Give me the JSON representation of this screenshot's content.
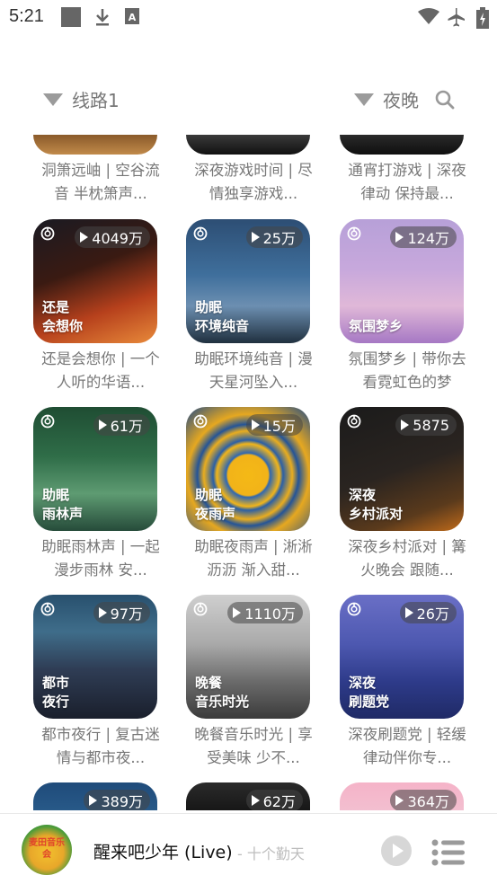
{
  "status_bar": {
    "time": "5:21"
  },
  "top_bar": {
    "route_label": "线路1",
    "mode_label": "夜晚"
  },
  "partial_top_row": [
    {
      "caption": "洞箫远岫 | 空谷流音 半枕箫声..."
    },
    {
      "caption": "深夜游戏时间 | 尽情独享游戏..."
    },
    {
      "caption": "通宵打游戏 | 深夜律动 保持最..."
    }
  ],
  "cards": [
    {
      "count": "4049万",
      "tag_line1": "还是",
      "tag_line2": "会想你",
      "caption": "还是会想你 | 一个人听的华语...",
      "bg": "linear-gradient(160deg,#1a1a22 0%,#3a1a12 40%,#b6401c 70%,#e88a3a 100%)"
    },
    {
      "count": "25万",
      "tag_line1": "助眠",
      "tag_line2": "环境纯音",
      "caption": "助眠环境纯音 | 漫天星河坠入...",
      "bg": "linear-gradient(180deg,#2d4e74 0%,#3f6f9c 45%,#6c8fb1 70%,#20303f 100%)"
    },
    {
      "count": "124万",
      "tag_line1": "氛围梦乡",
      "tag_line2": "",
      "caption": "氛围梦乡 | 带你去看霓虹色的梦",
      "bg": "linear-gradient(180deg,#b7a0d8 0%,#c7a8dc 40%,#e0b8d8 70%,#a678c4 100%)"
    },
    {
      "count": "61万",
      "tag_line1": "助眠",
      "tag_line2": "雨林声",
      "caption": "助眠雨林声 | 一起漫步雨林 安...",
      "bg": "linear-gradient(180deg,#1f4d33 0%,#2f6d48 40%,#5e9b72 70%,#264b3a 100%)"
    },
    {
      "count": "15万",
      "tag_line1": "助眠",
      "tag_line2": "夜雨声",
      "caption": "助眠夜雨声 | 淅淅沥沥 渐入甜...",
      "bg": "radial-gradient(circle at 50% 55%,#f4b916 0%,#f2b319 22%,#2f67b1 24%,#f1b51a 34%,#2a5fa6 38%,#e9ad1f 48%,#245497 55%,#e6a820 66%,#1f4a88 100%)"
    },
    {
      "count": "5875",
      "tag_line1": "深夜",
      "tag_line2": "乡村派对",
      "caption": "深夜乡村派对 | 篝火晚会 跟随...",
      "bg": "linear-gradient(160deg,#1b1b1b 0%,#2a2420 50%,#5a3a1c 80%,#c06a1a 100%)"
    },
    {
      "count": "97万",
      "tag_line1": "都市",
      "tag_line2": "夜行",
      "caption": "都市夜行 | 复古迷情与都市夜...",
      "bg": "linear-gradient(180deg,#28506e 0%,#3f6d8a 30%,#2f3d55 60%,#1a1f2c 100%)"
    },
    {
      "count": "1110万",
      "tag_line1": "晚餐",
      "tag_line2": "音乐时光",
      "caption": "晚餐音乐时光 | 享受美味 少不...",
      "bg": "linear-gradient(180deg,#cfcfcf 0%,#a9a9a9 40%,#6b6b6b 70%,#3b3b3b 100%)"
    },
    {
      "count": "26万",
      "tag_line1": "深夜",
      "tag_line2": "刷题党",
      "caption": "深夜刷题党 | 轻缓律动伴你专...",
      "bg": "linear-gradient(180deg,#6a6fc6 0%,#4d58b0 40%,#2e3b8a 70%,#1f2a66 100%)"
    }
  ],
  "partial_bottom_row": [
    {
      "count": "389万"
    },
    {
      "count": "62万"
    },
    {
      "count": "364万"
    }
  ],
  "player": {
    "album_text": "麦田音乐会",
    "title": "醒来吧少年 (Live)",
    "artist": "- 十个勤天"
  }
}
